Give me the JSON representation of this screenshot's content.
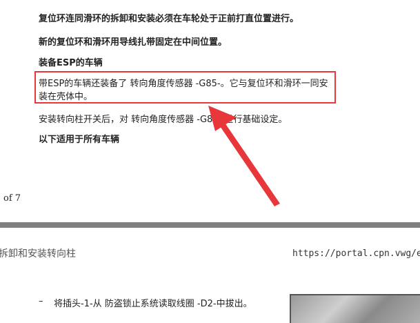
{
  "page_top": {
    "line1": "复位环连同滑环的拆卸和安装必须在车轮处于正前打直位置进行。",
    "line2": "新的复位环和滑环用导线扎带固定在中间位置。",
    "heading_esp": "装备ESP的车辆",
    "highlight_line1": "带ESP的车辆还装备了 转向角度传感器 -G85-。它与复位环和滑环一同安",
    "highlight_line2": "装在壳体中。",
    "line5": "安装转向柱开关后，对 转向角度传感器 -G85- 进行基础设定。",
    "heading_all": "以下适用于所有车辆",
    "page_indicator": "of 7"
  },
  "page_bottom": {
    "header_left": "拆卸和安装转向柱",
    "header_right": "https://portal.cpn.vwg/e",
    "bullet_dash": "–",
    "bullet_text": "将插头-1-从 防盗锁止系统读取线圈 -D2-中拔出。"
  },
  "annotation": {
    "highlight_color": "#e8373a",
    "arrow_color": "#e8373a"
  }
}
